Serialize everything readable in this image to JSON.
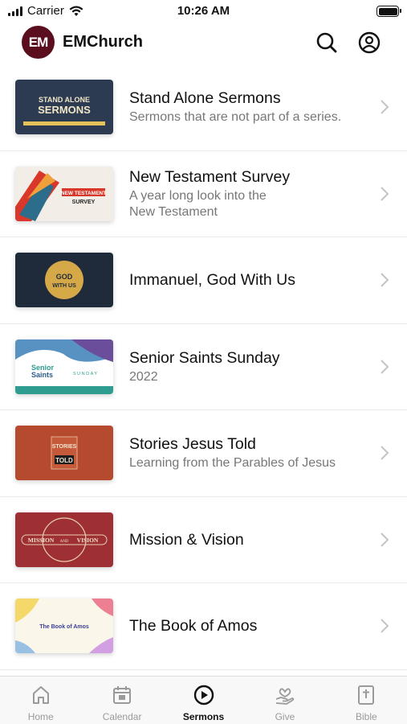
{
  "status_bar": {
    "carrier": "Carrier",
    "time": "10:26 AM"
  },
  "header": {
    "logo_text": "EM",
    "app_name": "EMChurch",
    "icons": [
      "search-icon",
      "account-icon"
    ]
  },
  "series": [
    {
      "title": "Stand Alone Sermons",
      "subtitle": "Sermons that are not part of a series.",
      "thumb_text": [
        "STAND ALONE",
        "SERMONS"
      ]
    },
    {
      "title": "New Testament Survey",
      "subtitle": "A year long look into the New Testament",
      "thumb_text": [
        "NEW TESTAMENT",
        "SURVEY"
      ]
    },
    {
      "title": "Immanuel, God With Us",
      "subtitle": "",
      "thumb_text": [
        "GOD",
        "WITH US"
      ]
    },
    {
      "title": "Senior Saints Sunday",
      "subtitle": "2022",
      "thumb_text": [
        "Senior",
        "Saints",
        "SUNDAY"
      ]
    },
    {
      "title": "Stories Jesus Told",
      "subtitle": "Learning from the Parables of Jesus",
      "thumb_text": [
        "STORIES",
        "TOLD"
      ]
    },
    {
      "title": "Mission & Vision",
      "subtitle": "",
      "thumb_text": [
        "MISSION",
        "AND",
        "VISION"
      ]
    },
    {
      "title": "The Book of Amos",
      "subtitle": "",
      "thumb_text": [
        "The Book of Amos"
      ]
    }
  ],
  "tabs": [
    {
      "label": "Home",
      "icon": "home-icon",
      "active": false
    },
    {
      "label": "Calendar",
      "icon": "calendar-icon",
      "active": false
    },
    {
      "label": "Sermons",
      "icon": "play-circle-icon",
      "active": true
    },
    {
      "label": "Give",
      "icon": "give-hand-icon",
      "active": false
    },
    {
      "label": "Bible",
      "icon": "bible-icon",
      "active": false
    }
  ],
  "colors": {
    "brand": "#5b0f1e",
    "active_tab": "#111111",
    "inactive_tab": "#9a9a9a"
  }
}
